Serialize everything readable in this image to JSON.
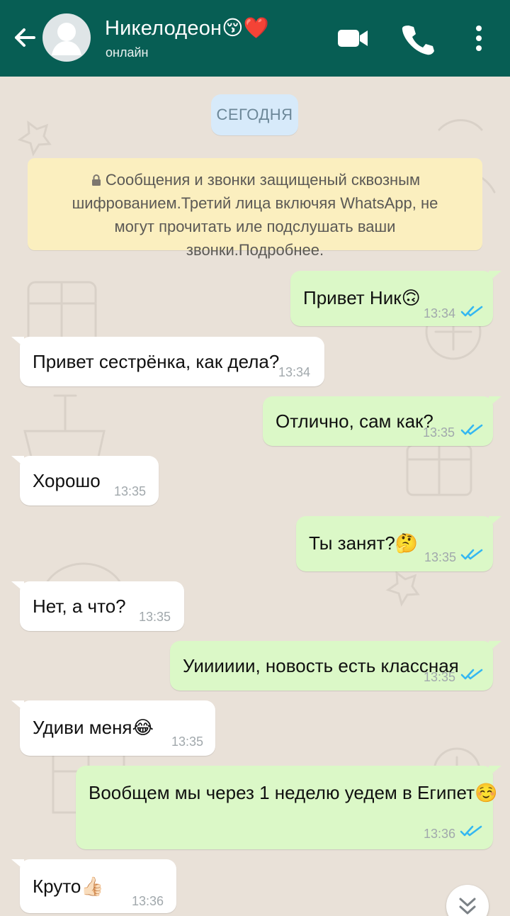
{
  "header": {
    "contact_name": "Никелодеон😚❤️",
    "contact_status": "онлайн"
  },
  "chat": {
    "date_label": "СЕГОДНЯ",
    "system_notice": "Сообщения и звонки защищеный сквозным шифрованием.Третий лица включяя WhatsApp, не могут прочитать иле подслушать ваши звонки.Подробнее.",
    "messages": [
      {
        "direction": "out",
        "text": "Привет Ник🙃",
        "time": "13:34",
        "read": true
      },
      {
        "direction": "in",
        "text": "Привет сестрёнка, как дела?",
        "time": "13:34"
      },
      {
        "direction": "out",
        "text": "Отлично, сам как?",
        "time": "13:35",
        "read": true
      },
      {
        "direction": "in",
        "text": "Хорошо",
        "time": "13:35"
      },
      {
        "direction": "out",
        "text": "Ты занят?🤔",
        "time": "13:35",
        "read": true
      },
      {
        "direction": "in",
        "text": "Нет, а что?",
        "time": "13:35"
      },
      {
        "direction": "out",
        "text": "Уииииии, новость есть классная",
        "time": "13:35",
        "read": true
      },
      {
        "direction": "in",
        "text": "Удиви меня😂",
        "time": "13:35"
      },
      {
        "direction": "out",
        "text": "Вообщем мы через 1 неделю уедем в Египет☺️",
        "time": "13:36",
        "read": true
      },
      {
        "direction": "in",
        "text": "Круто👍🏻",
        "time": "13:36"
      }
    ]
  },
  "colors": {
    "header": "#075e54",
    "chat_background": "#e9e1d8",
    "outgoing_bubble": "#dbf8c7",
    "incoming_bubble": "#ffffff",
    "read_ticks": "#34b7f1"
  }
}
